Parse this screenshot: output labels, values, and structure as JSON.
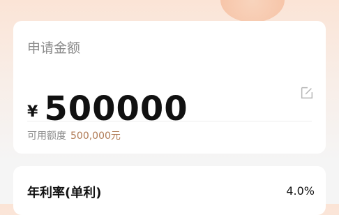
{
  "amount_card": {
    "title": "申请金额",
    "currency_symbol": "¥",
    "amount": "500000",
    "edit_icon": "edit-icon",
    "available_label": "可用额度",
    "available_value": "500,000元"
  },
  "rate_card": {
    "label": "年利率(单利)",
    "value": "4.0%"
  },
  "colors": {
    "accent_brown": "#b07a54",
    "header_peach": "#fbe4d6"
  }
}
